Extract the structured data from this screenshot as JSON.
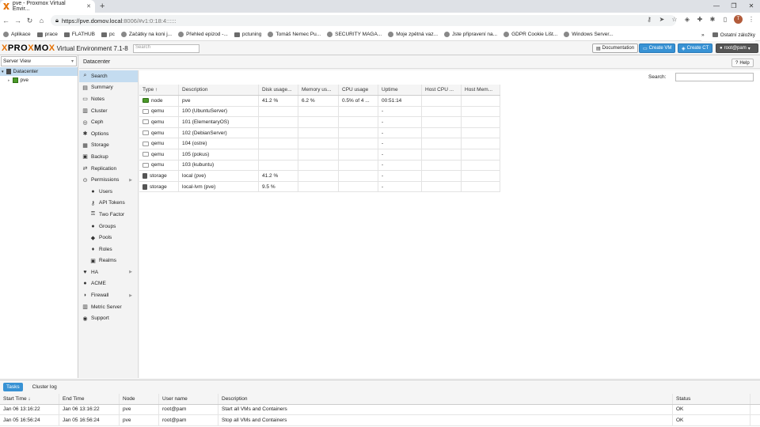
{
  "browser": {
    "tab_title": "pve - Proxmox Virtual Envir...",
    "url_host": "https://pve.domov.local",
    "url_path": ":8006/#v1:0:18:4::::::",
    "bookmarks": [
      "Aplikace",
      "prace",
      "FLATHUB",
      "pc",
      "Začátky na koni j...",
      "Přehled epizod -...",
      "pctuning",
      "Tomáš Nemec Pu...",
      "SECURITY MAGA...",
      "Moje zpětná vaz...",
      "Jste připravení na...",
      "GDPR Cookie Lišt...",
      "Windows Server..."
    ],
    "bookmarks_more": "»",
    "other_bookmarks": "Ostatní záložky",
    "avatar_letter": "T"
  },
  "header": {
    "logo_left": "PRO",
    "logo_x": "X",
    "logo_mid": "MO",
    "logo_x2": "X",
    "version": "Virtual Environment 7.1-8",
    "search_placeholder": "Search",
    "documentation": "Documentation",
    "create_vm": "Create VM",
    "create_ct": "Create CT",
    "user": "root@pam"
  },
  "tree": {
    "view": "Server View",
    "datacenter": "Datacenter",
    "node": "pve"
  },
  "content": {
    "breadcrumb": "Datacenter",
    "help": "Help",
    "search_label": "Search:"
  },
  "menu": [
    {
      "label": "Search",
      "icon": "search-icon",
      "glyph": "⌕",
      "sub": false,
      "sel": true
    },
    {
      "label": "Summary",
      "icon": "book-icon",
      "glyph": "▤",
      "sub": false
    },
    {
      "label": "Notes",
      "icon": "notes-icon",
      "glyph": "▭",
      "sub": false
    },
    {
      "label": "Cluster",
      "icon": "server-icon",
      "glyph": "▥",
      "sub": false
    },
    {
      "label": "Ceph",
      "icon": "ceph-icon",
      "glyph": "◎",
      "sub": false
    },
    {
      "label": "Options",
      "icon": "gear-icon",
      "glyph": "✱",
      "sub": false
    },
    {
      "label": "Storage",
      "icon": "database-icon",
      "glyph": "▦",
      "sub": false
    },
    {
      "label": "Backup",
      "icon": "floppy-icon",
      "glyph": "▣",
      "sub": false
    },
    {
      "label": "Replication",
      "icon": "retweet-icon",
      "glyph": "⇄",
      "sub": false
    },
    {
      "label": "Permissions",
      "icon": "unlock-icon",
      "glyph": "⊙",
      "sub": false,
      "exp": true
    },
    {
      "label": "Users",
      "icon": "user-icon",
      "glyph": "●",
      "sub": true
    },
    {
      "label": "API Tokens",
      "icon": "key-icon",
      "glyph": "⚷",
      "sub": true
    },
    {
      "label": "Two Factor",
      "icon": "key-icon",
      "glyph": "⚿",
      "sub": true
    },
    {
      "label": "Groups",
      "icon": "users-icon",
      "glyph": "●",
      "sub": true
    },
    {
      "label": "Pools",
      "icon": "tags-icon",
      "glyph": "◆",
      "sub": true
    },
    {
      "label": "Roles",
      "icon": "male-icon",
      "glyph": "♦",
      "sub": true
    },
    {
      "label": "Realms",
      "icon": "address-book-icon",
      "glyph": "▣",
      "sub": true
    },
    {
      "label": "HA",
      "icon": "heartbeat-icon",
      "glyph": "♥",
      "sub": false,
      "exp": true
    },
    {
      "label": "ACME",
      "icon": "certificate-icon",
      "glyph": "●",
      "sub": false
    },
    {
      "label": "Firewall",
      "icon": "shield-icon",
      "glyph": "◗",
      "sub": false,
      "exp": true
    },
    {
      "label": "Metric Server",
      "icon": "bar-chart-icon",
      "glyph": "▥",
      "sub": false
    },
    {
      "label": "Support",
      "icon": "support-icon",
      "glyph": "◉",
      "sub": false
    }
  ],
  "grid": {
    "columns": [
      "Type ↑",
      "Description",
      "Disk usage...",
      "Memory us...",
      "CPU usage",
      "Uptime",
      "Host CPU ...",
      "Host Mem..."
    ],
    "rows": [
      {
        "type": "node",
        "desc": "pve",
        "disk": "41.2 %",
        "mem": "6.2 %",
        "cpu": "0.5% of 4 ...",
        "uptime": "00:51:14",
        "icon": "node"
      },
      {
        "type": "qemu",
        "desc": "100 (UbuntuServer)",
        "disk": "",
        "mem": "",
        "cpu": "",
        "uptime": "-",
        "icon": "vm"
      },
      {
        "type": "qemu",
        "desc": "101 (ElementaryOS)",
        "disk": "",
        "mem": "",
        "cpu": "",
        "uptime": "-",
        "icon": "vm"
      },
      {
        "type": "qemu",
        "desc": "102 (DebianServer)",
        "disk": "",
        "mem": "",
        "cpu": "",
        "uptime": "-",
        "icon": "vm"
      },
      {
        "type": "qemu",
        "desc": "104 (ostre)",
        "disk": "",
        "mem": "",
        "cpu": "",
        "uptime": "-",
        "icon": "vm"
      },
      {
        "type": "qemu",
        "desc": "105 (pokus)",
        "disk": "",
        "mem": "",
        "cpu": "",
        "uptime": "-",
        "icon": "vm"
      },
      {
        "type": "qemu",
        "desc": "103 (kubuntu)",
        "disk": "",
        "mem": "",
        "cpu": "",
        "uptime": "-",
        "icon": "vm"
      },
      {
        "type": "storage",
        "desc": "local (pve)",
        "disk": "41.2 %",
        "mem": "",
        "cpu": "",
        "uptime": "-",
        "icon": "stor"
      },
      {
        "type": "storage",
        "desc": "local-lvm (pve)",
        "disk": "9.5 %",
        "mem": "",
        "cpu": "",
        "uptime": "-",
        "icon": "stor"
      }
    ]
  },
  "bottom": {
    "tabs": [
      "Tasks",
      "Cluster log"
    ],
    "columns": [
      "Start Time ↓",
      "End Time",
      "Node",
      "User name",
      "Description",
      "Status"
    ],
    "rows": [
      [
        "Jan 06 13:16:22",
        "Jan 06 13:16:22",
        "pve",
        "root@pam",
        "Start all VMs and Containers",
        "OK"
      ],
      [
        "Jan 05 16:56:24",
        "Jan 05 16:56:24",
        "pve",
        "root@pam",
        "Stop all VMs and Containers",
        "OK"
      ]
    ]
  }
}
